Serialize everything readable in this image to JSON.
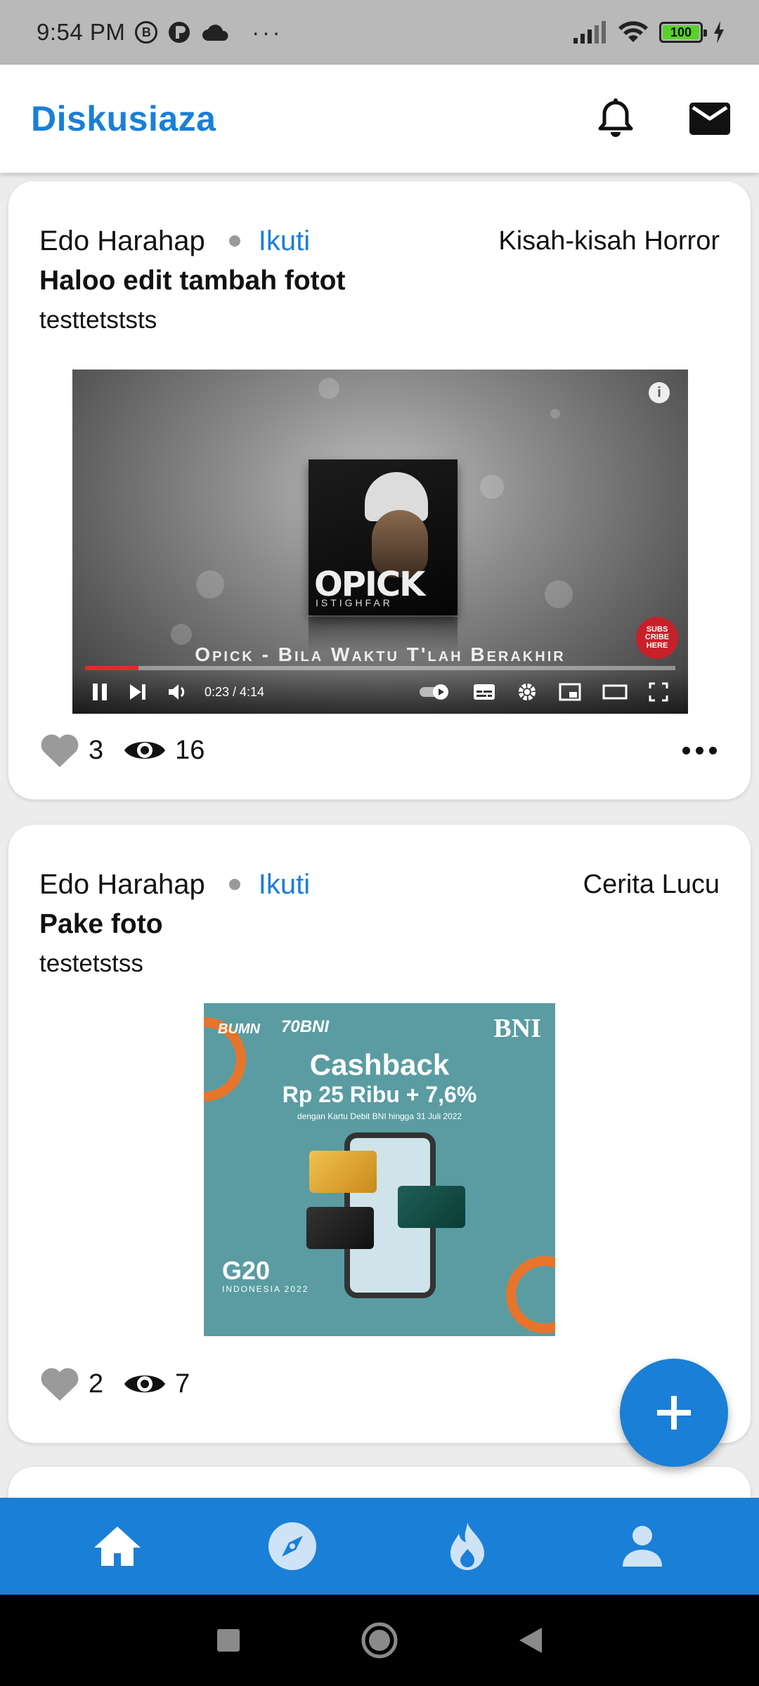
{
  "status_bar": {
    "time": "9:54 PM",
    "notif_icons": [
      "b-circle-icon",
      "p-circle-icon",
      "cloud-icon"
    ],
    "more": "···",
    "battery": "100"
  },
  "app_bar": {
    "title": "Diskusiaza",
    "actions": [
      "bell-icon",
      "mail-icon"
    ]
  },
  "posts": [
    {
      "author": "Edo Harahap",
      "follow_label": "Ikuti",
      "category": "Kisah-kisah Horror",
      "title": "Haloo edit tambah fotot",
      "body": "testtetststs",
      "likes": "3",
      "views": "16",
      "media": {
        "type": "video",
        "album_title": "OPICK",
        "album_subtitle": "ISTIGHFAR",
        "video_caption": "Opick - Bila Waktu T'lah Berakhir",
        "time": "0:23 / 4:14",
        "progress": 0.09,
        "subscribe": "SUBS CRIBE HERE"
      }
    },
    {
      "author": "Edo Harahap",
      "follow_label": "Ikuti",
      "category": "Cerita Lucu",
      "title": "Pake foto",
      "body": "testetstss",
      "likes": "2",
      "views": "7",
      "media": {
        "type": "image",
        "brand": "BNI",
        "bumn": "BUMN",
        "bni70": "70BNI",
        "headline": "Cashback",
        "amount": "Rp 25 Ribu + 7,6%",
        "subtext": "dengan Kartu Debit BNI hingga 31 Juli 2022",
        "g20": "G20",
        "g20_sub": "INDONESIA 2022"
      }
    }
  ],
  "bottom_nav": [
    "home-icon",
    "compass-icon",
    "flame-icon",
    "person-icon"
  ],
  "colors": {
    "primary": "#1a7fd6",
    "status_bar": "#b9b9b9",
    "background": "#ececec"
  }
}
